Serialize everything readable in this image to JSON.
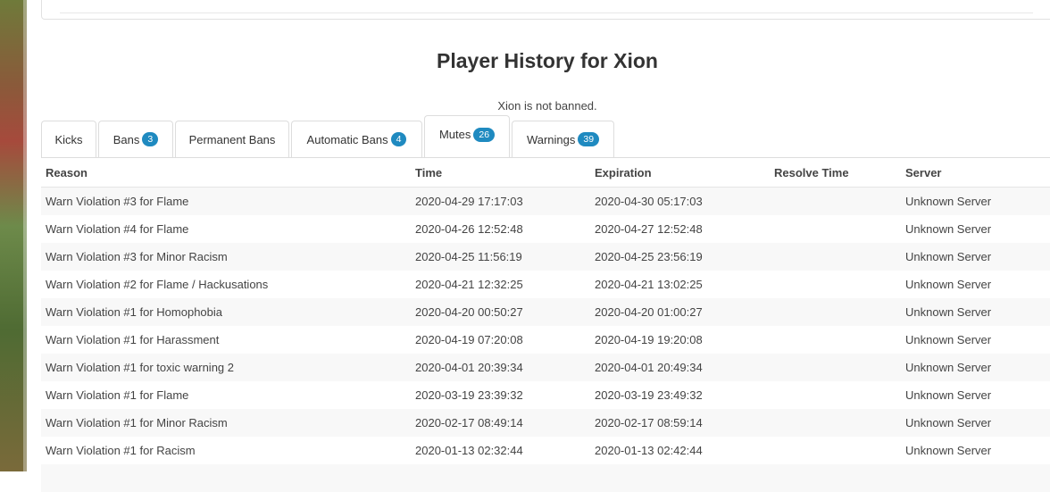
{
  "page": {
    "title": "Player History for Xion",
    "ban_status": "Xion is not banned."
  },
  "tabs": [
    {
      "label": "Kicks",
      "badge": null,
      "active": false
    },
    {
      "label": "Bans",
      "badge": "3",
      "active": false
    },
    {
      "label": "Permanent Bans",
      "badge": null,
      "active": false
    },
    {
      "label": "Automatic Bans",
      "badge": "4",
      "active": false
    },
    {
      "label": "Mutes",
      "badge": "26",
      "active": true
    },
    {
      "label": "Warnings",
      "badge": "39",
      "active": false
    }
  ],
  "table": {
    "headers": [
      "Reason",
      "Time",
      "Expiration",
      "Resolve Time",
      "Server"
    ],
    "rows": [
      {
        "reason": "Warn Violation #3 for Flame",
        "time": "2020-04-29 17:17:03",
        "expiration": "2020-04-30 05:17:03",
        "resolve": "",
        "server": "Unknown Server"
      },
      {
        "reason": "Warn Violation #4 for Flame",
        "time": "2020-04-26 12:52:48",
        "expiration": "2020-04-27 12:52:48",
        "resolve": "",
        "server": "Unknown Server"
      },
      {
        "reason": "Warn Violation #3 for Minor Racism",
        "time": "2020-04-25 11:56:19",
        "expiration": "2020-04-25 23:56:19",
        "resolve": "",
        "server": "Unknown Server"
      },
      {
        "reason": "Warn Violation #2 for Flame / Hackusations",
        "time": "2020-04-21 12:32:25",
        "expiration": "2020-04-21 13:02:25",
        "resolve": "",
        "server": "Unknown Server"
      },
      {
        "reason": "Warn Violation #1 for Homophobia",
        "time": "2020-04-20 00:50:27",
        "expiration": "2020-04-20 01:00:27",
        "resolve": "",
        "server": "Unknown Server"
      },
      {
        "reason": "Warn Violation #1 for Harassment",
        "time": "2020-04-19 07:20:08",
        "expiration": "2020-04-19 19:20:08",
        "resolve": "",
        "server": "Unknown Server"
      },
      {
        "reason": "Warn Violation #1 for toxic warning 2",
        "time": "2020-04-01 20:39:34",
        "expiration": "2020-04-01 20:49:34",
        "resolve": "",
        "server": "Unknown Server"
      },
      {
        "reason": "Warn Violation #1 for Flame",
        "time": "2020-03-19 23:39:32",
        "expiration": "2020-03-19 23:49:32",
        "resolve": "",
        "server": "Unknown Server"
      },
      {
        "reason": "Warn Violation #1 for Minor Racism",
        "time": "2020-02-17 08:49:14",
        "expiration": "2020-02-17 08:59:14",
        "resolve": "",
        "server": "Unknown Server"
      },
      {
        "reason": "Warn Violation #1 for Racism",
        "time": "2020-01-13 02:32:44",
        "expiration": "2020-01-13 02:42:44",
        "resolve": "",
        "server": "Unknown Server"
      }
    ]
  },
  "colors": {
    "badge": "#1f8ac0",
    "stripe": "#f8f8f8",
    "border": "#dddddd"
  }
}
